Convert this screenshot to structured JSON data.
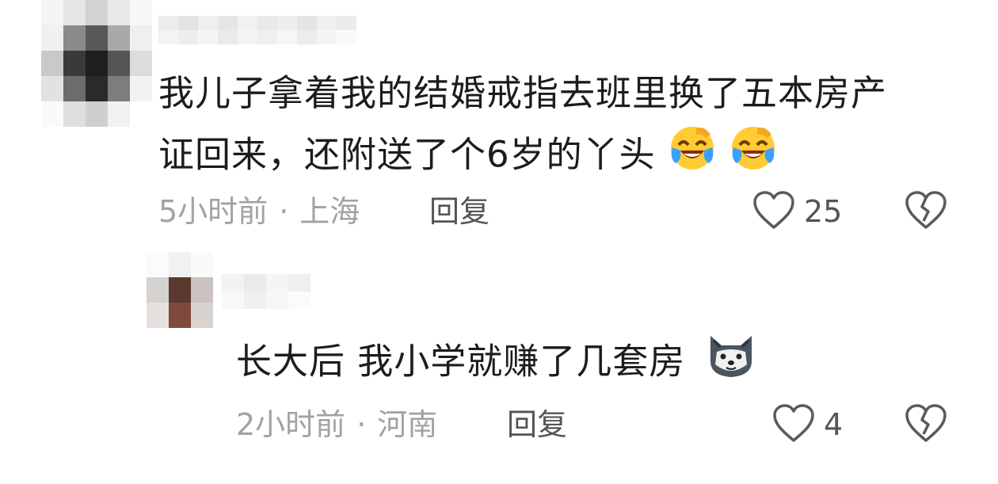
{
  "comments": [
    {
      "text_line1": "我儿子拿着我的结婚戒指去班里换了五本房产",
      "text_line2": "证回来，还附送了个6岁的丫头",
      "trailing_emoji": "laughing-crying-emoji",
      "time": "5小时前",
      "location": "上海",
      "reply_label": "回复",
      "like_count": "25"
    },
    {
      "text": "长大后 我小学就赚了几套房",
      "trailing_emoji": "doge-emoji",
      "time": "2小时前",
      "location": "河南",
      "reply_label": "回复",
      "like_count": "4"
    }
  ],
  "separator": "·",
  "colors": {
    "text": "#1c1c1c",
    "meta": "#a2a2a2",
    "action": "#545454",
    "emoji_yellow": "#ffcc33",
    "emoji_tear": "#3aa0ff"
  }
}
